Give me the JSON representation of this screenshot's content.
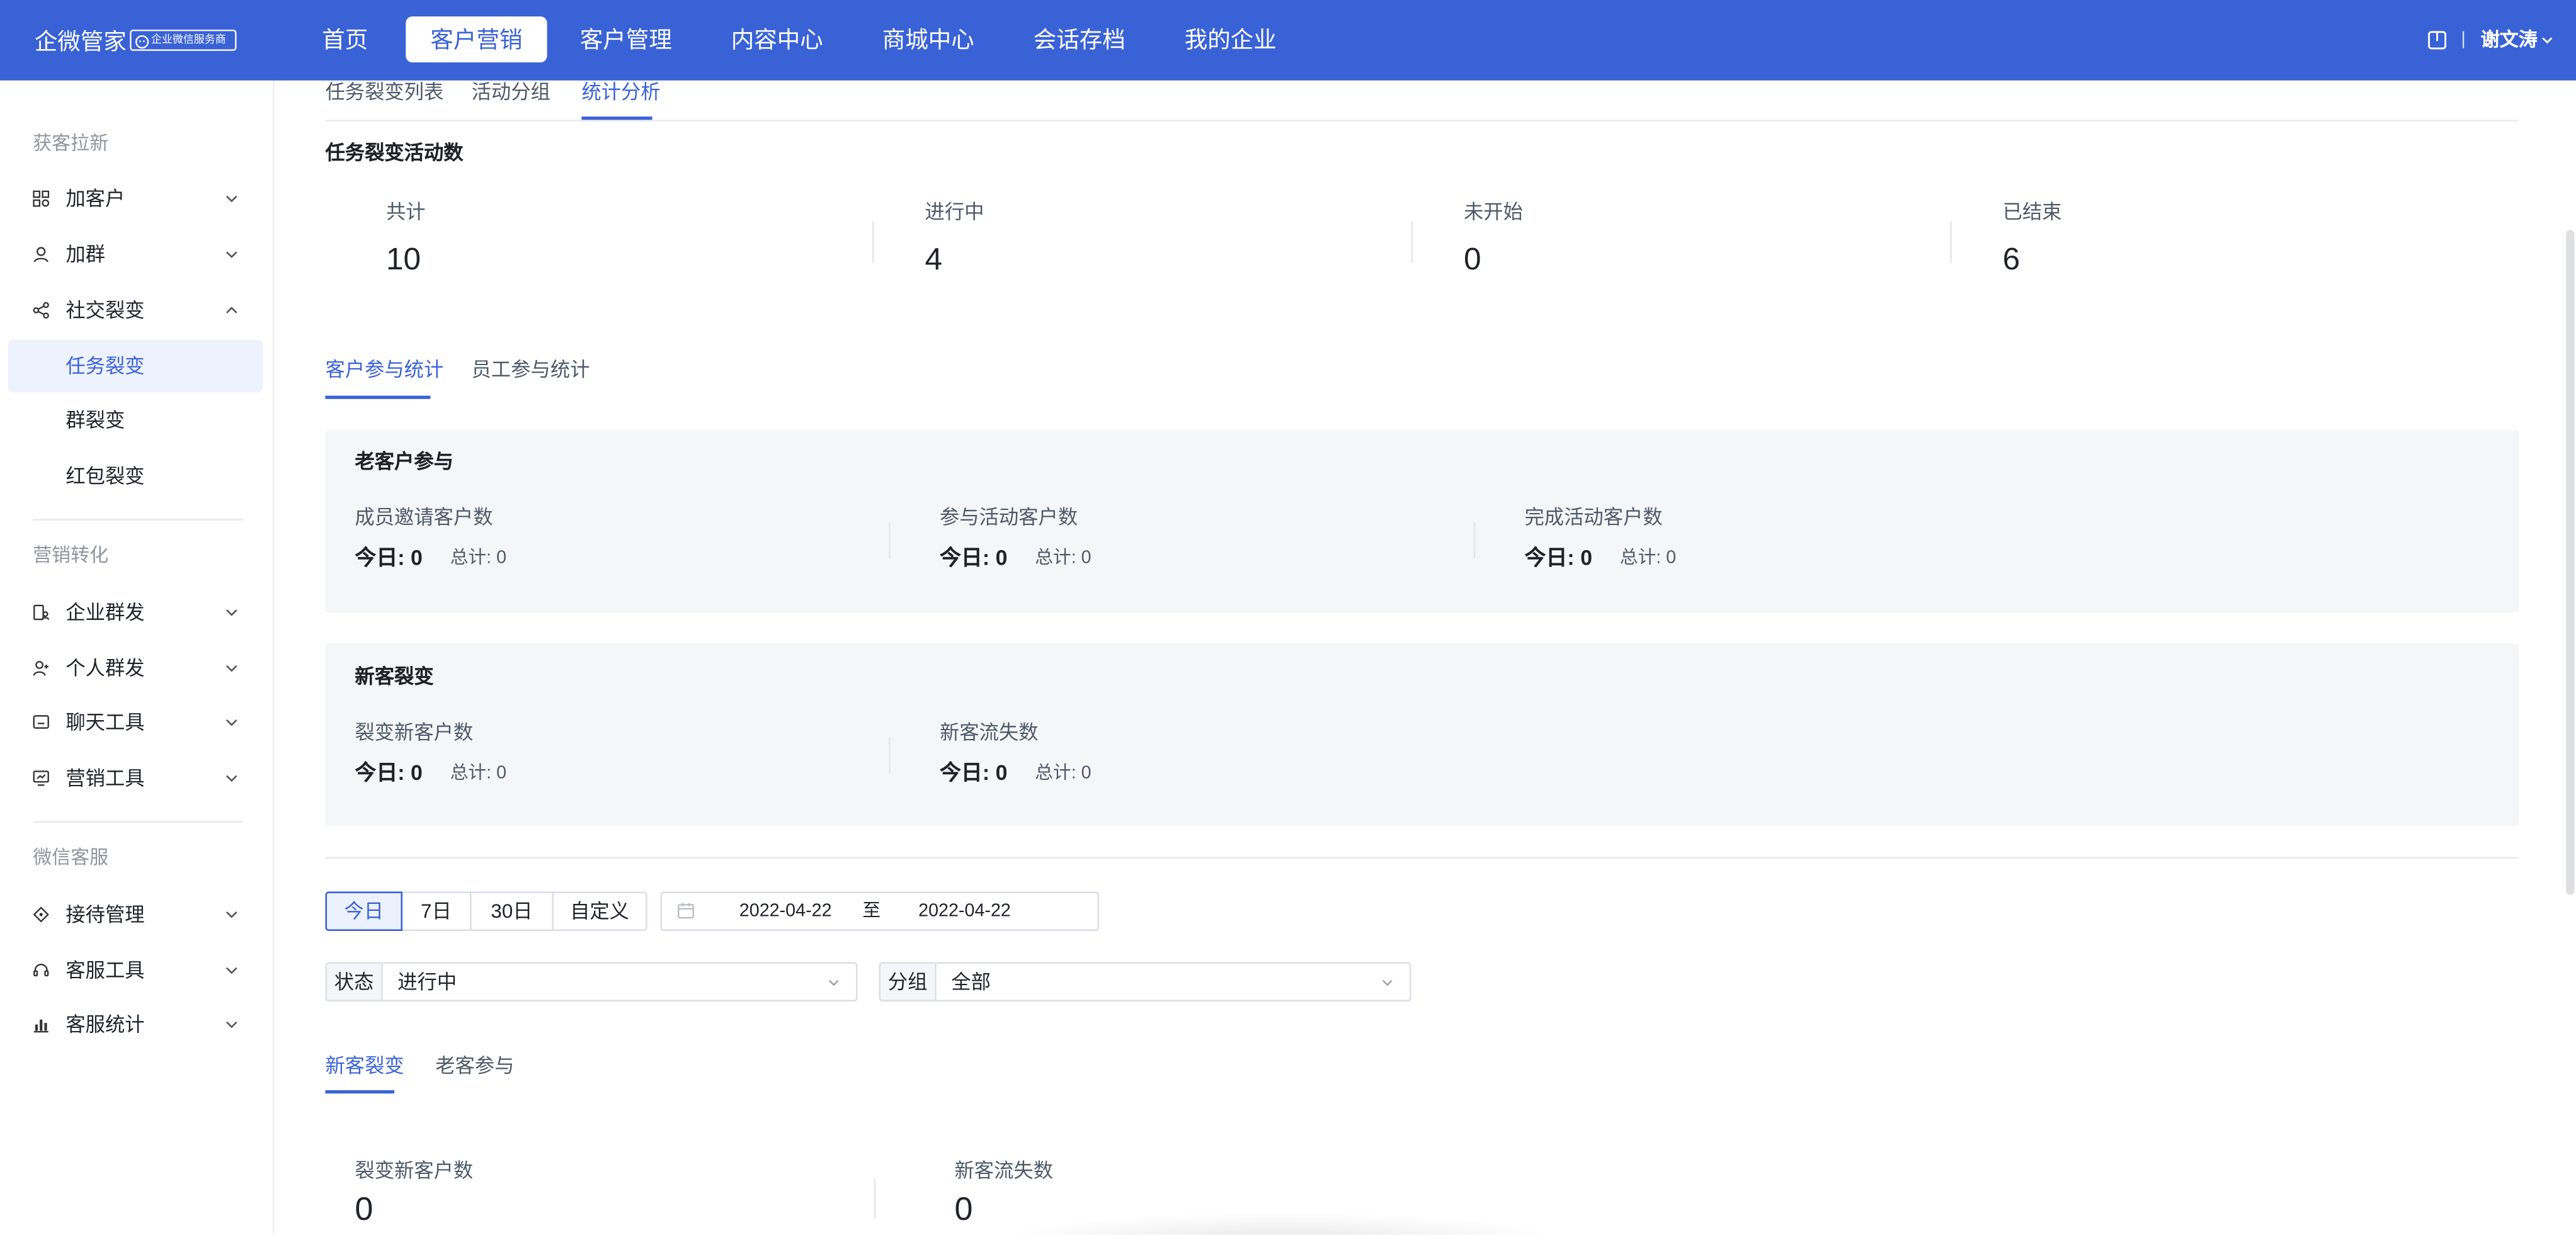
{
  "app": {
    "title": "企微管家",
    "badge": "企业微信服务商"
  },
  "nav": {
    "items": [
      {
        "label": "首页"
      },
      {
        "label": "客户营销",
        "active": true
      },
      {
        "label": "客户管理"
      },
      {
        "label": "内容中心"
      },
      {
        "label": "商城中心"
      },
      {
        "label": "会话存档"
      },
      {
        "label": "我的企业"
      }
    ]
  },
  "user": {
    "icon": "book-icon",
    "separator": "|",
    "name": "谢文涛"
  },
  "sidebar": {
    "sections": [
      {
        "title": "获客拉新",
        "items": [
          {
            "label": "加客户",
            "icon": "grid-icon"
          },
          {
            "label": "加群",
            "icon": "user-icon"
          },
          {
            "label": "社交裂变",
            "icon": "share-icon",
            "expanded": true,
            "children": [
              {
                "label": "任务裂变",
                "active": true
              },
              {
                "label": "群裂变"
              },
              {
                "label": "红包裂变"
              }
            ]
          }
        ]
      },
      {
        "title": "营销转化",
        "items": [
          {
            "label": "企业群发",
            "icon": "enterprise-broadcast-icon"
          },
          {
            "label": "个人群发",
            "icon": "personal-broadcast-icon"
          },
          {
            "label": "聊天工具",
            "icon": "chat-tool-icon"
          },
          {
            "label": "营销工具",
            "icon": "marketing-tool-icon"
          }
        ]
      },
      {
        "title": "微信客服",
        "items": [
          {
            "label": "接待管理",
            "icon": "tag-icon"
          },
          {
            "label": "客服工具",
            "icon": "headset-icon"
          },
          {
            "label": "客服统计",
            "icon": "bar-chart-icon"
          }
        ]
      }
    ]
  },
  "page_tabs": [
    {
      "label": "任务裂变列表"
    },
    {
      "label": "活动分组"
    },
    {
      "label": "统计分析",
      "active": true
    }
  ],
  "activity_summary": {
    "title": "任务裂变活动数",
    "stats": [
      {
        "label": "共计",
        "value": "10"
      },
      {
        "label": "进行中",
        "value": "4"
      },
      {
        "label": "未开始",
        "value": "0"
      },
      {
        "label": "已结束",
        "value": "6"
      }
    ]
  },
  "participation_tabs": [
    {
      "label": "客户参与统计",
      "active": true
    },
    {
      "label": "员工参与统计"
    }
  ],
  "old_customer_card": {
    "title": "老客户参与",
    "metrics": [
      {
        "label": "成员邀请客户数",
        "today_label": "今日:",
        "today": "0",
        "total_label": "总计:",
        "total": "0"
      },
      {
        "label": "参与活动客户数",
        "today_label": "今日:",
        "today": "0",
        "total_label": "总计:",
        "total": "0"
      },
      {
        "label": "完成活动客户数",
        "today_label": "今日:",
        "today": "0",
        "total_label": "总计:",
        "total": "0"
      }
    ]
  },
  "new_customer_card": {
    "title": "新客裂变",
    "metrics": [
      {
        "label": "裂变新客户数",
        "today_label": "今日:",
        "today": "0",
        "total_label": "总计:",
        "total": "0"
      },
      {
        "label": "新客流失数",
        "today_label": "今日:",
        "today": "0",
        "total_label": "总计:",
        "total": "0"
      }
    ]
  },
  "filters": {
    "range_buttons": [
      {
        "label": "今日",
        "active": true
      },
      {
        "label": "7日"
      },
      {
        "label": "30日"
      },
      {
        "label": "自定义"
      }
    ],
    "date_start": "2022-04-22",
    "date_separator": "至",
    "date_end": "2022-04-22",
    "status": {
      "label": "状态",
      "value": "进行中"
    },
    "group": {
      "label": "分组",
      "value": "全部"
    }
  },
  "detail_tabs": [
    {
      "label": "新客裂变",
      "active": true
    },
    {
      "label": "老客参与"
    }
  ],
  "detail_stats": [
    {
      "label": "裂变新客户数",
      "value": "0"
    },
    {
      "label": "新客流失数",
      "value": "0"
    }
  ],
  "colors": {
    "primary": "#3a62d7",
    "sidebar_active_bg": "#eef2fd",
    "card_bg": "#f5f6f8",
    "text": "#1f2329",
    "muted": "#8f959e"
  }
}
